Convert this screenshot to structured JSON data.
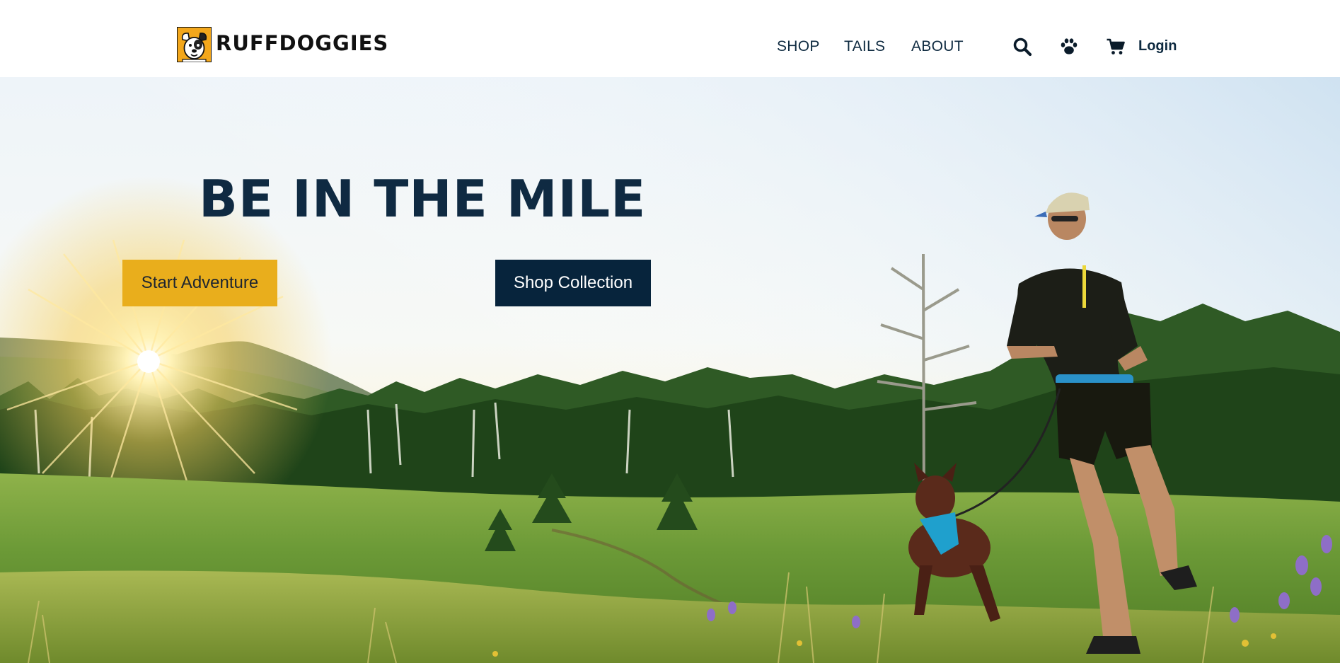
{
  "brand": {
    "name": "RUFFDOGGIES",
    "logo_icon": "dog-face-icon"
  },
  "nav": {
    "shop": "SHOP",
    "tails": "TAILS",
    "about": "ABOUT"
  },
  "actions": {
    "search_icon": "search-icon",
    "paw_icon": "paw-icon",
    "cart_icon": "cart-icon",
    "login": "Login"
  },
  "hero": {
    "title": "BE IN THE MILE",
    "primary_button": "Start Adventure",
    "secondary_button": "Shop Collection"
  },
  "colors": {
    "navy": "#0f2a42",
    "gold": "#e9ae1c",
    "dark_button": "#07243c",
    "header_bg": "#ffffff"
  }
}
